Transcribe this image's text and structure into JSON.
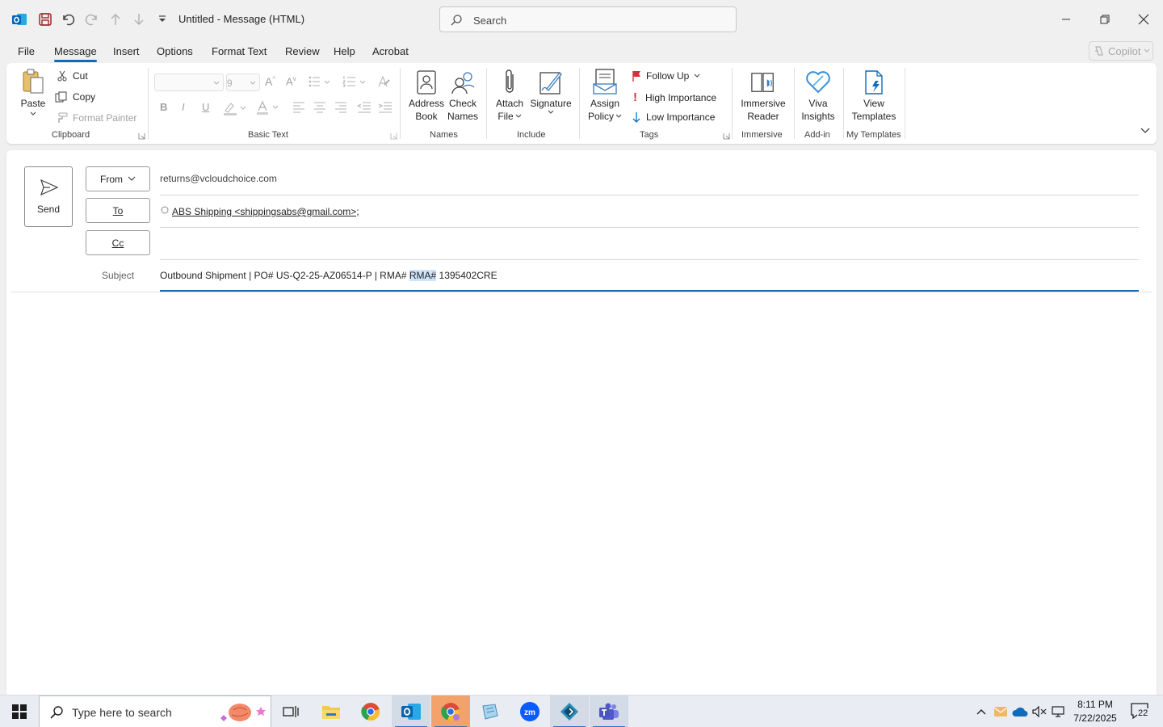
{
  "window": {
    "title": "Untitled  -  Message (HTML)",
    "search_placeholder": "Search"
  },
  "menu": {
    "tabs": [
      "File",
      "Message",
      "Insert",
      "Options",
      "Format Text",
      "Review",
      "Help",
      "Acrobat"
    ],
    "active": "Message",
    "copilot_label": "Copilot"
  },
  "ribbon": {
    "clipboard": {
      "paste": "Paste",
      "cut": "Cut",
      "copy": "Copy",
      "format_painter": "Format Painter",
      "label": "Clipboard"
    },
    "basic_text": {
      "font_size": "9",
      "label": "Basic Text"
    },
    "names": {
      "address_book": [
        "Address",
        "Book"
      ],
      "check_names": [
        "Check",
        "Names"
      ],
      "label": "Names"
    },
    "include": {
      "attach_file": [
        "Attach",
        "File"
      ],
      "signature": "Signature",
      "label": "Include"
    },
    "tags": {
      "assign_policy": [
        "Assign",
        "Policy"
      ],
      "follow_up": "Follow Up",
      "high_importance": "High Importance",
      "low_importance": "Low Importance",
      "label": "Tags"
    },
    "immersive": {
      "reader": [
        "Immersive",
        "Reader"
      ],
      "label": "Immersive"
    },
    "addin": {
      "viva": [
        "Viva",
        "Insights"
      ],
      "label": "Add-in"
    },
    "templates": {
      "view": [
        "View",
        "Templates"
      ],
      "label": "My Templates"
    }
  },
  "compose": {
    "send_label": "Send",
    "from_label": "From",
    "from_value": "returns@vcloudchoice.com",
    "to_label": "To",
    "to_value": "ABS Shipping <shippingsabs@gmail.com>;",
    "cc_label": "Cc",
    "subject_label": "Subject",
    "subject_before": "Outbound Shipment | PO# US-Q2-25-AZ06514-P | RMA# ",
    "subject_selected": "RMA#",
    "subject_after": " 1395402CRE"
  },
  "taskbar": {
    "search_placeholder": "Type here to search",
    "time": "8:11 PM",
    "date": "7/22/2025",
    "notification_count": "22"
  },
  "colors": {
    "accent": "#0f6cbd",
    "flag_red": "#d13438",
    "outlook_blue": "#0a64b0"
  }
}
